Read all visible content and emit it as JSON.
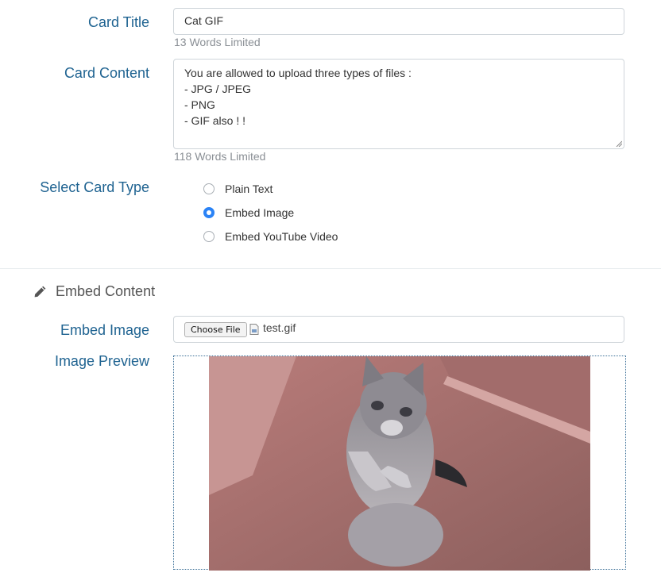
{
  "card_title": {
    "label": "Card Title",
    "value": "Cat GIF",
    "hint": "13 Words Limited"
  },
  "card_content": {
    "label": "Card Content",
    "lines": [
      "You are allowed to upload three types of files :",
      "- JPG / JPEG",
      "- PNG",
      "- GIF also ! !"
    ],
    "hint": "118 Words Limited"
  },
  "card_type": {
    "label": "Select Card Type",
    "options": [
      {
        "label": "Plain Text",
        "checked": false
      },
      {
        "label": "Embed Image",
        "checked": true
      },
      {
        "label": "Embed YouTube Video",
        "checked": false
      }
    ]
  },
  "embed_section": {
    "title": "Embed Content",
    "icon": "pencil-icon",
    "embed_image_label": "Embed Image",
    "choose_file_label": "Choose File",
    "file_name": "test.gif",
    "preview_label": "Image Preview"
  },
  "colors": {
    "label": "#1f6391",
    "radio_checked": "#2b83f6",
    "hint": "#8a8f95"
  }
}
